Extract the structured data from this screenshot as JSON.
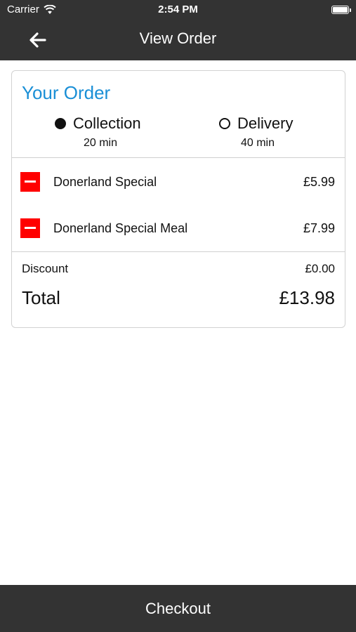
{
  "status_bar": {
    "carrier": "Carrier",
    "time": "2:54 PM"
  },
  "nav": {
    "title": "View Order",
    "back_icon": "arrow-left-icon"
  },
  "order": {
    "title": "Your Order",
    "options": [
      {
        "label": "Collection",
        "time": "20 min",
        "selected": true
      },
      {
        "label": "Delivery",
        "time": "40 min",
        "selected": false
      }
    ],
    "items": [
      {
        "name": "Donerland Special",
        "price": "£5.99"
      },
      {
        "name": "Donerland Special Meal",
        "price": "£7.99"
      }
    ],
    "discount_label": "Discount",
    "discount_value": "£0.00",
    "total_label": "Total",
    "total_value": "£13.98"
  },
  "checkout_label": "Checkout",
  "colors": {
    "bar": "#333333",
    "accent": "#1a8fd6",
    "remove": "#ff0000"
  }
}
